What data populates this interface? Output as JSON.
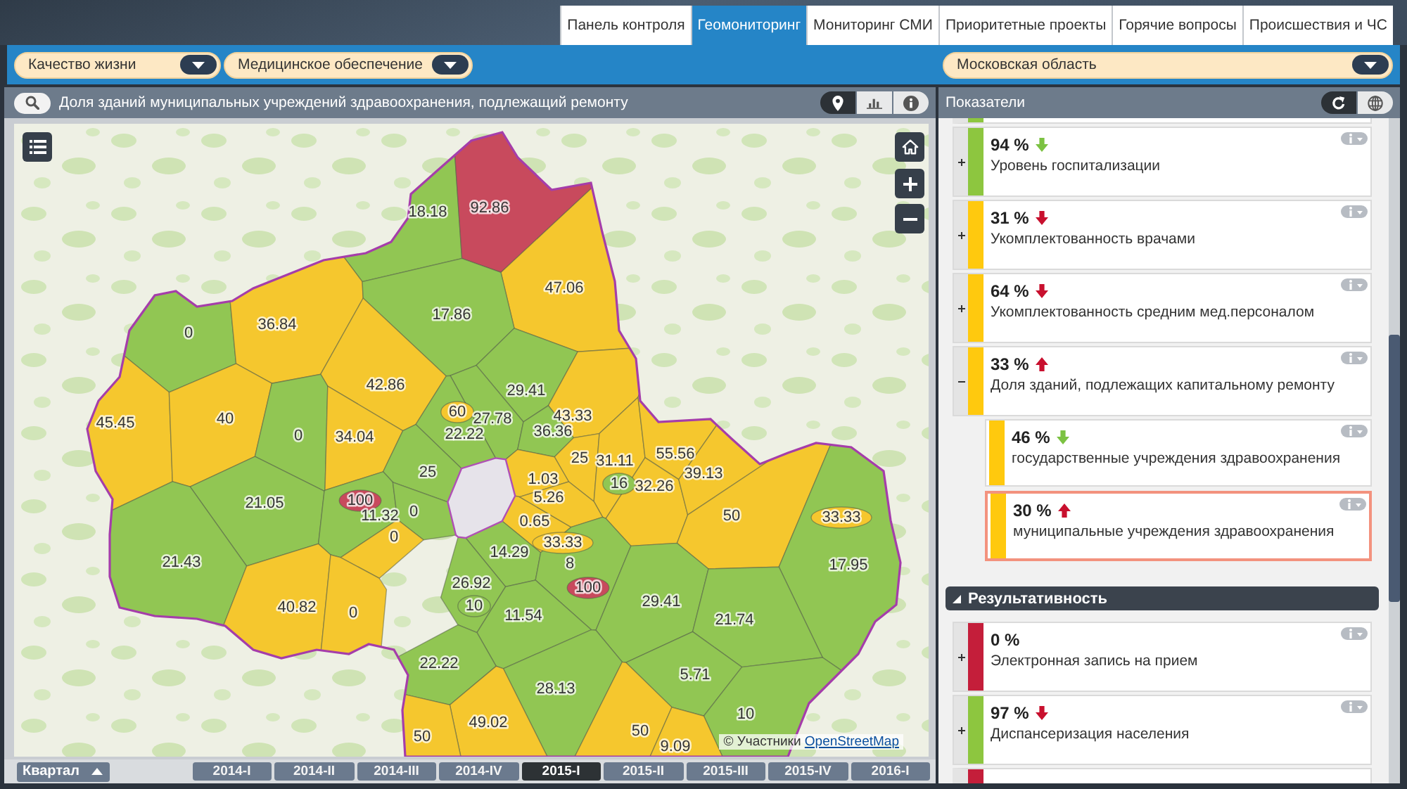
{
  "top_tabs": [
    {
      "label": "Панель контроля",
      "selected": false
    },
    {
      "label": "Геомониторинг",
      "selected": true
    },
    {
      "label": "Мониторинг СМИ",
      "selected": false
    },
    {
      "label": "Приоритетные проекты",
      "selected": false
    },
    {
      "label": "Горячие вопросы",
      "selected": false
    },
    {
      "label": "Происшествия и ЧС",
      "selected": false
    }
  ],
  "filters": [
    {
      "value": "Качество жизни"
    },
    {
      "value": "Медицинское обеспечение"
    }
  ],
  "region_select": {
    "value": "Московская область"
  },
  "map_panel": {
    "title": "Доля зданий муниципальных учреждений здравоохранения, подлежащий ремонту",
    "view_toggles": [
      {
        "selected": true
      },
      {
        "selected": false
      },
      {
        "selected": false
      }
    ],
    "regions": [
      {
        "value": "18.18",
        "color": "#91c653"
      },
      {
        "value": "92.86",
        "color": "#c84a5d"
      },
      {
        "value": "47.06",
        "color": "#f5c72e"
      },
      {
        "value": "0",
        "color": "#91c653"
      },
      {
        "value": "36.84",
        "color": "#f5c72e"
      },
      {
        "value": "17.86",
        "color": "#91c653"
      },
      {
        "value": "42.86",
        "color": "#f5c72e"
      },
      {
        "value": "29.41",
        "color": "#91c653"
      },
      {
        "value": "45.45",
        "color": "#f5c72e"
      },
      {
        "value": "40",
        "color": "#f5c72e"
      },
      {
        "value": "60",
        "color": "#f5c72e"
      },
      {
        "value": "27.78",
        "color": "#91c653"
      },
      {
        "value": "43.33",
        "color": "#f5c72e"
      },
      {
        "value": "0",
        "color": "#91c653"
      },
      {
        "value": "34.04",
        "color": "#f5c72e"
      },
      {
        "value": "22.22",
        "color": "#91c653"
      },
      {
        "value": "36.36",
        "color": "#91c653"
      },
      {
        "value": "25",
        "color": "#f5c72e"
      },
      {
        "value": "31.11",
        "color": "#f5c72e"
      },
      {
        "value": "55.56",
        "color": "#f5c72e"
      },
      {
        "value": "25",
        "color": "#91c653"
      },
      {
        "value": "1.03",
        "color": "#f5c72e"
      },
      {
        "value": "16",
        "color": "#91c653"
      },
      {
        "value": "32.26",
        "color": "#f5c72e"
      },
      {
        "value": "39.13",
        "color": "#f5c72e"
      },
      {
        "value": "21.05",
        "color": "#91c653"
      },
      {
        "value": "100",
        "color": "#c84a5d"
      },
      {
        "value": "11.32",
        "color": "#91c653"
      },
      {
        "value": "0",
        "color": "#91c653"
      },
      {
        "value": "0.65",
        "color": "#f5c72e"
      },
      {
        "value": "5.26",
        "color": "#f5c72e"
      },
      {
        "value": "50",
        "color": "#f5c72e"
      },
      {
        "value": "33.33",
        "color": "#f5c72e"
      },
      {
        "value": "0",
        "color": "#f5c72e"
      },
      {
        "value": "14.29",
        "color": "#91c653"
      },
      {
        "value": "33.33",
        "color": "#f5c72e"
      },
      {
        "value": "21.43",
        "color": "#91c653"
      },
      {
        "value": "8",
        "color": "#91c653"
      },
      {
        "value": "17.95",
        "color": "#91c653"
      },
      {
        "value": "26.92",
        "color": "#91c653"
      },
      {
        "value": "100",
        "color": "#c84a5d"
      },
      {
        "value": "40.82",
        "color": "#f5c72e"
      },
      {
        "value": "0",
        "color": "#f5c72e"
      },
      {
        "value": "10",
        "color": "#91c653"
      },
      {
        "value": "11.54",
        "color": "#91c653"
      },
      {
        "value": "29.41",
        "color": "#91c653"
      },
      {
        "value": "21.74",
        "color": "#91c653"
      },
      {
        "value": "22.22",
        "color": "#91c653"
      },
      {
        "value": "28.13",
        "color": "#91c653"
      },
      {
        "value": "5.71",
        "color": "#91c653"
      },
      {
        "value": "49.02",
        "color": "#f5c72e"
      },
      {
        "value": "10",
        "color": "#91c653"
      },
      {
        "value": "50",
        "color": "#f5c72e"
      },
      {
        "value": "50",
        "color": "#f5c72e"
      },
      {
        "value": "9.09",
        "color": "#f5c72e"
      }
    ],
    "attribution": {
      "text": "© Участники",
      "link": "OpenStreetMap"
    }
  },
  "timeline": {
    "period": "Квартал",
    "quarters": [
      {
        "label": "2014-I",
        "selected": false
      },
      {
        "label": "2014-II",
        "selected": false
      },
      {
        "label": "2014-III",
        "selected": false
      },
      {
        "label": "2014-IV",
        "selected": false
      },
      {
        "label": "2015-I",
        "selected": true
      },
      {
        "label": "2015-II",
        "selected": false
      },
      {
        "label": "2015-III",
        "selected": false
      },
      {
        "label": "2015-IV",
        "selected": false
      },
      {
        "label": "2016-I",
        "selected": false
      }
    ]
  },
  "indicators_panel": {
    "title": "Показатели",
    "view_toggles": [
      {
        "selected": true
      },
      {
        "selected": false
      }
    ],
    "items": [
      {
        "kind": "clipped",
        "color": "#8dc63f"
      },
      {
        "kind": "indicator",
        "value": "94 %",
        "trend": {
          "up": false,
          "color": "#7cc242"
        },
        "label": "Уровень госпитализации",
        "color": "#8dc63f",
        "expanded": false,
        "selected": false
      },
      {
        "kind": "indicator",
        "value": "31 %",
        "trend": {
          "up": false,
          "color": "#c8102e"
        },
        "label": "Укомплектованность врачами",
        "color": "#ffc90e",
        "expanded": false,
        "selected": false
      },
      {
        "kind": "indicator",
        "value": "64 %",
        "trend": {
          "up": false,
          "color": "#c8102e"
        },
        "label": "Укомплектованность средним мед.персоналом",
        "color": "#ffc90e",
        "expanded": false,
        "selected": false
      },
      {
        "kind": "indicator",
        "value": "33 %",
        "trend": {
          "up": true,
          "color": "#c8102e"
        },
        "label": "Доля зданий, подлежащих капитальному ремонту",
        "color": "#ffc90e",
        "expanded": true,
        "selected": false,
        "children": [
          {
            "value": "46 %",
            "trend": {
              "up": false,
              "color": "#7cc242"
            },
            "label": "государственные учреждения здравоохранения",
            "color": "#ffc90e",
            "selected": false
          },
          {
            "value": "30 %",
            "trend": {
              "up": true,
              "color": "#c8102e"
            },
            "label": "муниципальные учреждения здравоохранения",
            "color": "#ffc90e",
            "selected": true
          }
        ]
      },
      {
        "kind": "section",
        "label": "Результативность",
        "expanded": true
      },
      {
        "kind": "indicator",
        "value": "0 %",
        "label": "Электронная запись на прием",
        "color": "#c41e3a",
        "expanded": false,
        "selected": false
      },
      {
        "kind": "indicator",
        "value": "97 %",
        "trend": {
          "up": false,
          "color": "#c8102e"
        },
        "label": "Диспансеризация населения",
        "color": "#8dc63f",
        "expanded": false,
        "selected": false
      },
      {
        "kind": "clipped",
        "color": "#c41e3a"
      }
    ]
  }
}
